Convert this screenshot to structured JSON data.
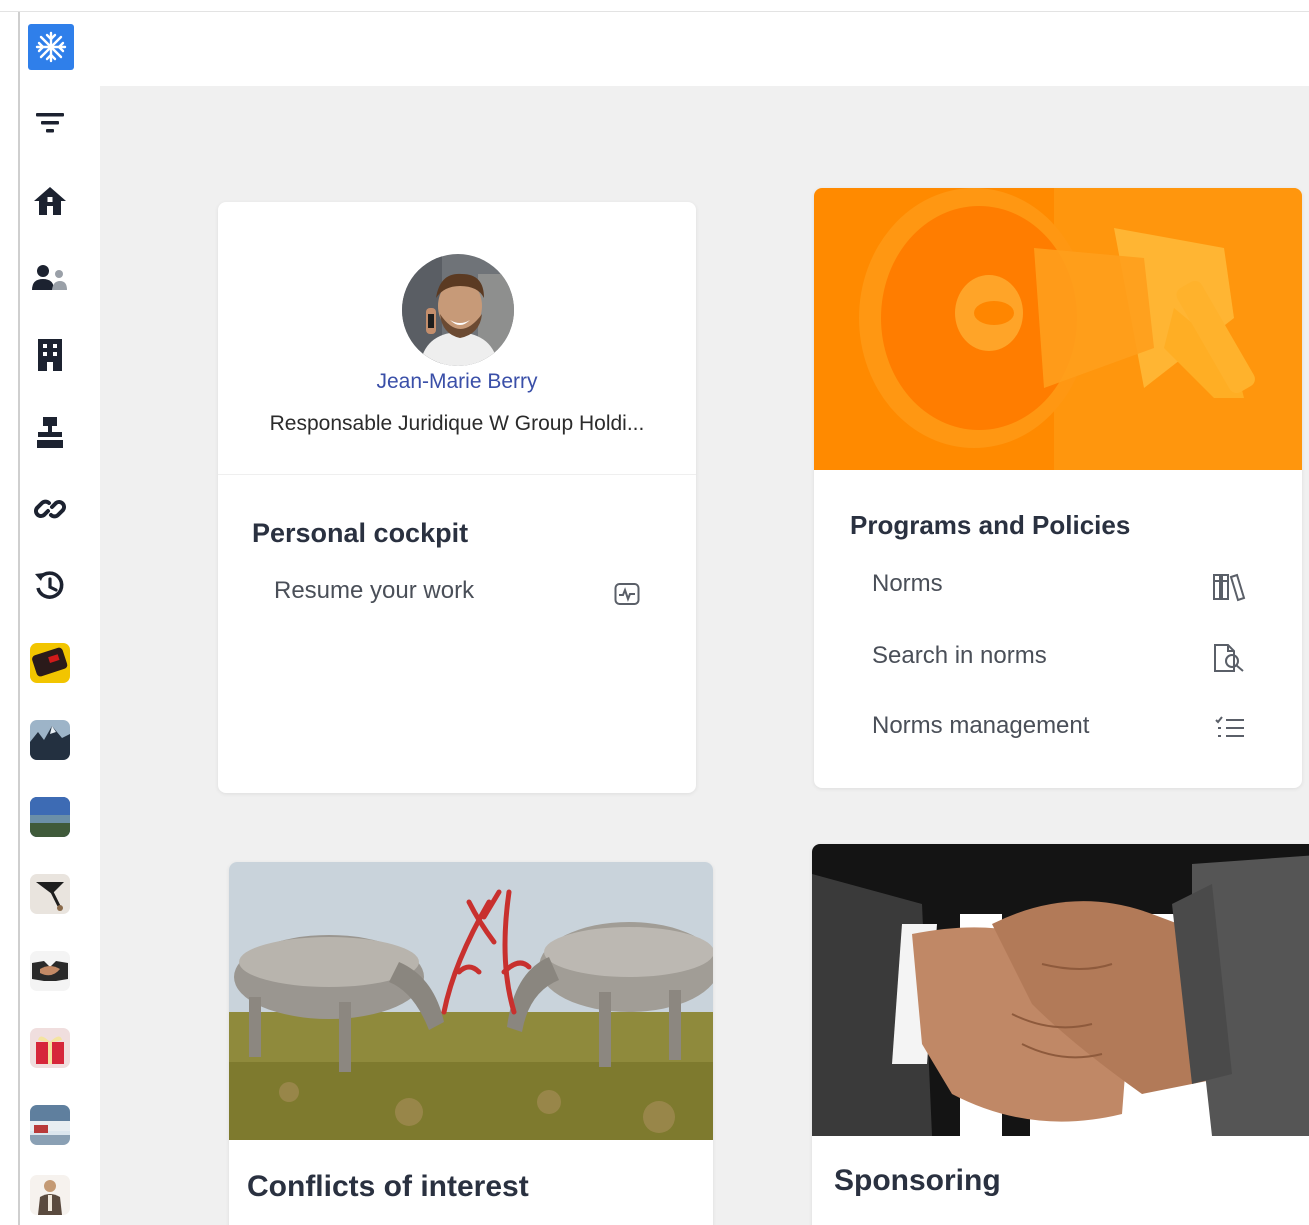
{
  "sidebar": {
    "logo_icon": "snowflake-logo-icon",
    "items": [
      {
        "icon": "filter-icon"
      },
      {
        "icon": "home-icon"
      },
      {
        "icon": "users-icon"
      },
      {
        "icon": "building-icon"
      },
      {
        "icon": "hierarchy-icon"
      },
      {
        "icon": "link-icon"
      },
      {
        "icon": "history-icon"
      },
      {
        "icon": "app-thumbnail"
      },
      {
        "icon": "app-thumbnail"
      },
      {
        "icon": "app-thumbnail"
      },
      {
        "icon": "app-thumbnail"
      },
      {
        "icon": "app-thumbnail"
      },
      {
        "icon": "app-thumbnail"
      },
      {
        "icon": "app-thumbnail"
      },
      {
        "icon": "app-thumbnail"
      }
    ]
  },
  "profile": {
    "name": "Jean-Marie Berry",
    "role": "Responsable Juridique W Group Holdi..."
  },
  "cockpit": {
    "title": "Personal cockpit",
    "items": [
      {
        "label": "Resume your work",
        "icon": "activity-icon"
      }
    ]
  },
  "programs": {
    "title": "Programs and Policies",
    "items": [
      {
        "label": "Norms",
        "icon": "library-icon"
      },
      {
        "label": "Search in norms",
        "icon": "file-search-icon"
      },
      {
        "label": "Norms management",
        "icon": "checklist-icon"
      }
    ]
  },
  "conflicts": {
    "title": "Conflicts of interest"
  },
  "sponsoring": {
    "title": "Sponsoring"
  },
  "colors": {
    "accent_blue": "#2f7fea",
    "name_blue": "#3a4fa8",
    "background": "#f0f0f0",
    "megaphone_orange": "#ff8a00"
  }
}
